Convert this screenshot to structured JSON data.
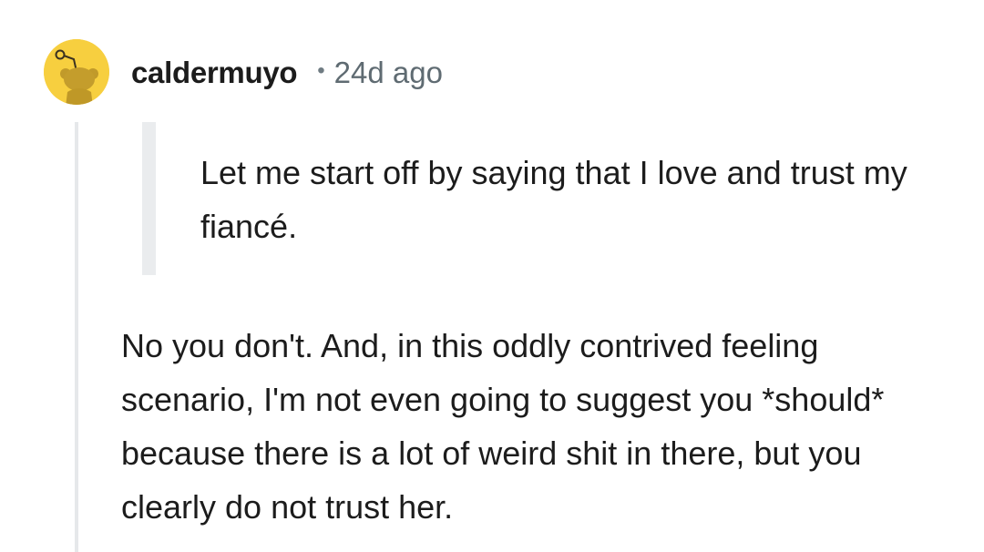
{
  "comment": {
    "username": "caldermuyo",
    "separator": "•",
    "timestamp": "24d ago",
    "avatar_icon": "snoo-avatar-icon",
    "avatar_color": "#f7cf3f",
    "quote": "Let me start off by saying that I love and trust my fiancé.",
    "body": "No you don't. And, in this oddly contrived feeling scenario, I'm not even going to suggest you *should* because there is a lot of weird shit in there, but you clearly do not trust her."
  }
}
